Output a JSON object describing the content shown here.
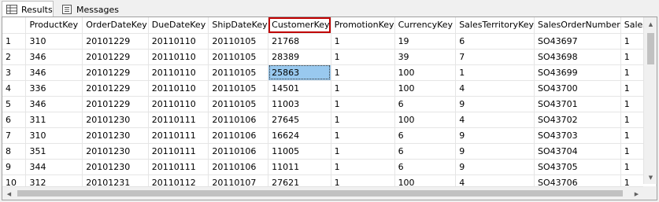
{
  "tabs": [
    {
      "label": "Results",
      "icon": "grid-icon",
      "active": true
    },
    {
      "label": "Messages",
      "icon": "messages-icon",
      "active": false
    }
  ],
  "grid": {
    "columns": [
      "",
      "ProductKey",
      "OrderDateKey",
      "DueDateKey",
      "ShipDateKey",
      "CustomerKey",
      "PromotionKey",
      "CurrencyKey",
      "SalesTerritoryKey",
      "SalesOrderNumber",
      "Sales"
    ],
    "highlighted_column": "CustomerKey",
    "selected_cell": {
      "row": 3,
      "column": "CustomerKey"
    },
    "rows": [
      [
        "1",
        "310",
        "20101229",
        "20110110",
        "20110105",
        "21768",
        "1",
        "19",
        "6",
        "SO43697",
        "1"
      ],
      [
        "2",
        "346",
        "20101229",
        "20110110",
        "20110105",
        "28389",
        "1",
        "39",
        "7",
        "SO43698",
        "1"
      ],
      [
        "3",
        "346",
        "20101229",
        "20110110",
        "20110105",
        "25863",
        "1",
        "100",
        "1",
        "SO43699",
        "1"
      ],
      [
        "4",
        "336",
        "20101229",
        "20110110",
        "20110105",
        "14501",
        "1",
        "100",
        "4",
        "SO43700",
        "1"
      ],
      [
        "5",
        "346",
        "20101229",
        "20110110",
        "20110105",
        "11003",
        "1",
        "6",
        "9",
        "SO43701",
        "1"
      ],
      [
        "6",
        "311",
        "20101230",
        "20110111",
        "20110106",
        "27645",
        "1",
        "100",
        "4",
        "SO43702",
        "1"
      ],
      [
        "7",
        "310",
        "20101230",
        "20110111",
        "20110106",
        "16624",
        "1",
        "6",
        "9",
        "SO43703",
        "1"
      ],
      [
        "8",
        "351",
        "20101230",
        "20110111",
        "20110106",
        "11005",
        "1",
        "6",
        "9",
        "SO43704",
        "1"
      ],
      [
        "9",
        "344",
        "20101230",
        "20110111",
        "20110106",
        "11011",
        "1",
        "6",
        "9",
        "SO43705",
        "1"
      ],
      [
        "10",
        "312",
        "20101231",
        "20110112",
        "20110107",
        "27621",
        "1",
        "100",
        "4",
        "SO43706",
        "1"
      ]
    ]
  },
  "colors": {
    "highlight_border": "#c00000",
    "selected_cell_bg": "#99c9ef"
  }
}
